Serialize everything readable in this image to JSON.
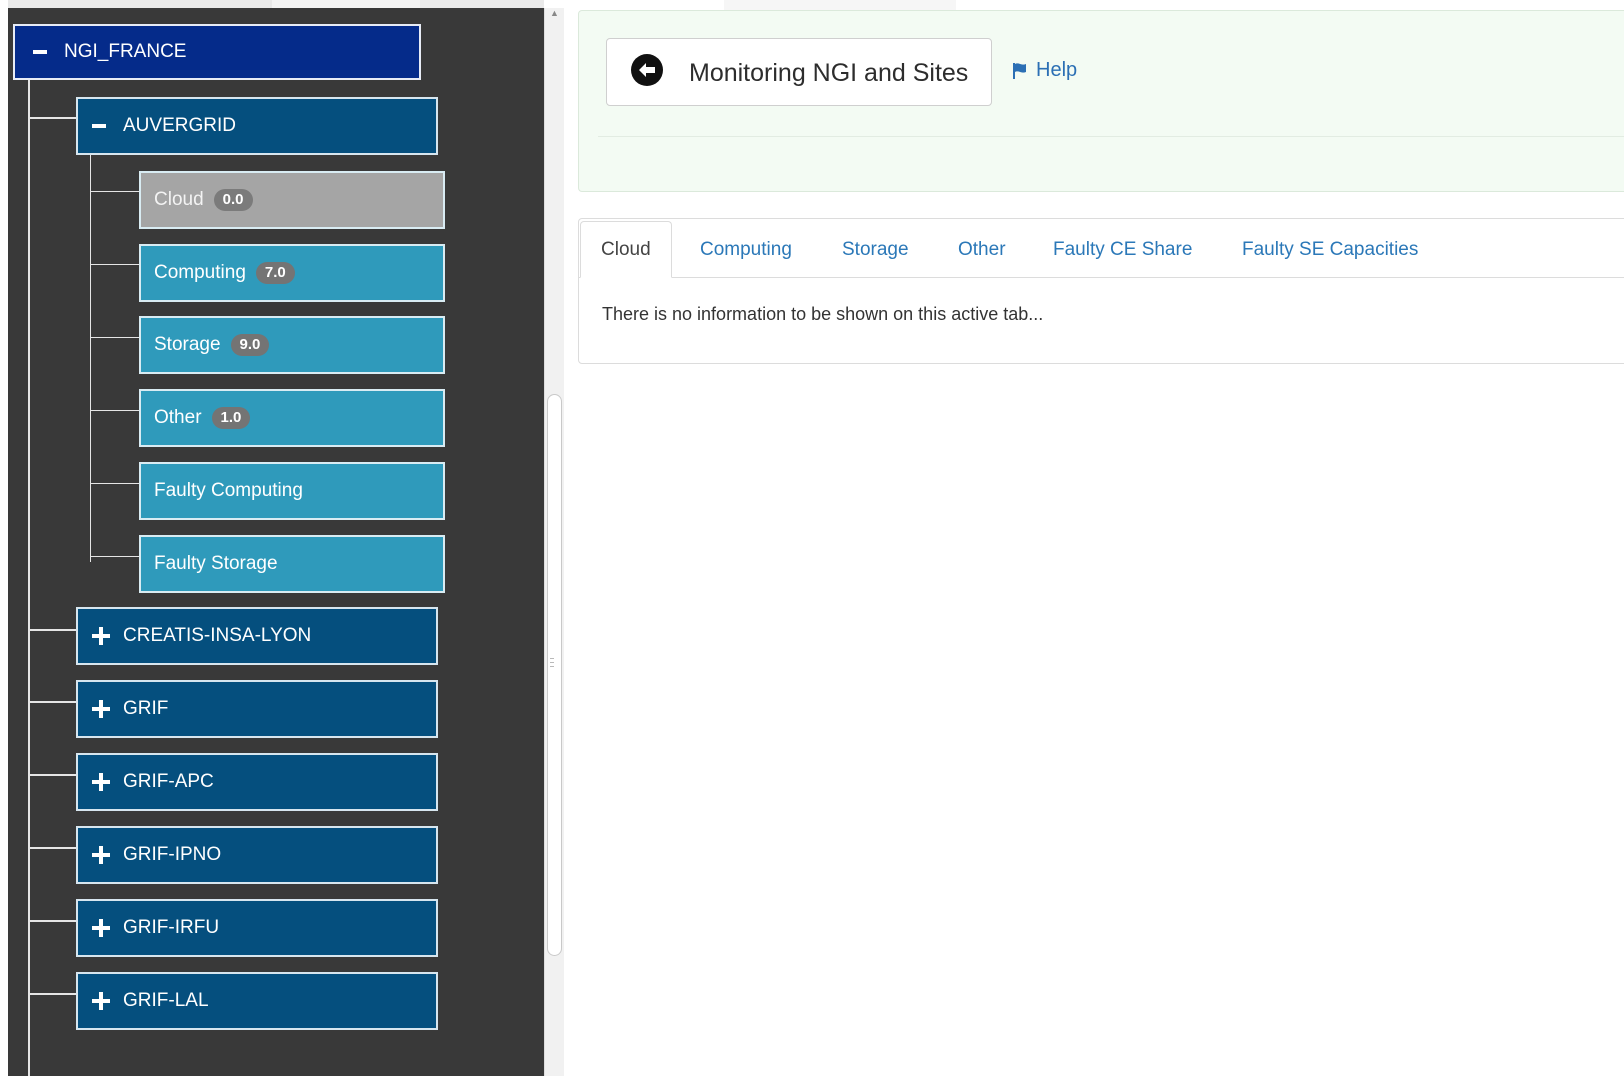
{
  "tree": {
    "root": {
      "label": "NGI_FRANCE",
      "toggle": "minus-icon"
    },
    "expanded_site": {
      "label": "AUVERGRID",
      "toggle": "minus-icon",
      "children": [
        {
          "label": "Cloud",
          "badge": "0.0",
          "state": "gray"
        },
        {
          "label": "Computing",
          "badge": "7.0"
        },
        {
          "label": "Storage",
          "badge": "9.0"
        },
        {
          "label": "Other",
          "badge": "1.0"
        },
        {
          "label": "Faulty Computing"
        },
        {
          "label": "Faulty Storage"
        }
      ]
    },
    "collapsed_sites": [
      {
        "label": "CREATIS-INSA-LYON",
        "toggle": "plus-icon"
      },
      {
        "label": "GRIF",
        "toggle": "plus-icon"
      },
      {
        "label": "GRIF-APC",
        "toggle": "plus-icon"
      },
      {
        "label": "GRIF-IPNO",
        "toggle": "plus-icon"
      },
      {
        "label": "GRIF-IRFU",
        "toggle": "plus-icon"
      },
      {
        "label": "GRIF-LAL",
        "toggle": "plus-icon"
      }
    ]
  },
  "header": {
    "title": "Monitoring NGI and Sites",
    "back_icon": "arrow-left-circle-icon",
    "help_label": "Help",
    "help_icon": "flag-icon"
  },
  "tabs": [
    {
      "label": "Cloud",
      "active": true
    },
    {
      "label": "Computing"
    },
    {
      "label": "Storage"
    },
    {
      "label": "Other"
    },
    {
      "label": "Faulty CE Share"
    },
    {
      "label": "Faulty SE Capacities"
    }
  ],
  "tab_content": {
    "message": "There is no information to be shown on this active tab..."
  },
  "colors": {
    "ngi_node": "#052b8a",
    "site_node": "#054f7e",
    "leaf_node": "#2f9abb",
    "leaf_disabled": "#a5a5a5",
    "tree_background": "#393939",
    "link": "#2b78b8",
    "header_background": "#f3fbf3"
  }
}
